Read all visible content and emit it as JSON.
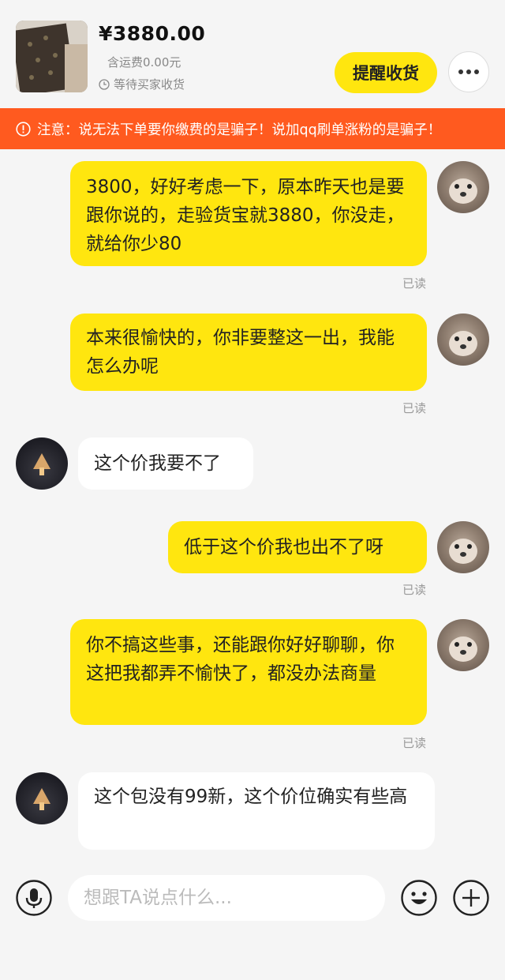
{
  "header": {
    "price": "¥3880.00",
    "shipping": "含运费0.00元",
    "status": "等待买家收货",
    "remind_label": "提醒收货",
    "more_label": "•••"
  },
  "warning": {
    "text": "注意：说无法下单要你缴费的是骗子！说加qq刷单涨粉的是骗子！"
  },
  "messages": [
    {
      "side": "me",
      "text": "3800，好好考虑一下，原本昨天也是要跟你说的，走验货宝就3880，你没走，就给你少80",
      "read": "已读"
    },
    {
      "side": "me",
      "text": "本来很愉快的，你非要整这一出，我能怎么办呢",
      "read": "已读"
    },
    {
      "side": "other",
      "text": "这个价我要不了"
    },
    {
      "side": "me",
      "text": "低于这个价我也出不了呀",
      "read": "已读"
    },
    {
      "side": "me",
      "text": "你不搞这些事，还能跟你好好聊聊，你这把我都弄不愉快了，都没办法商量",
      "read": "已读"
    },
    {
      "side": "other",
      "text": "这个包没有99新，这个价位确实有些高"
    }
  ],
  "input": {
    "placeholder": "想跟TA说点什么..."
  },
  "colors": {
    "accent_yellow": "#ffe60f",
    "warning_orange": "#ff5a1f",
    "background": "#f5f5f5"
  },
  "icons": [
    "clock-icon",
    "warning-icon",
    "microphone-icon",
    "emoji-icon",
    "plus-icon",
    "more-icon"
  ]
}
